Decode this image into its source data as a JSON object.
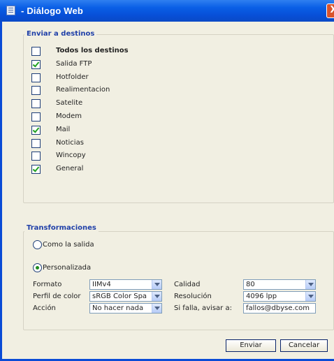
{
  "window": {
    "title": "- Diálogo Web",
    "close_glyph": "X",
    "title_icon": "document-icon"
  },
  "destinations": {
    "legend": "Enviar a destinos",
    "items": [
      {
        "label": "Todos los destinos",
        "checked": false,
        "bold": true
      },
      {
        "label": "Salida FTP",
        "checked": true
      },
      {
        "label": "Hotfolder",
        "checked": false
      },
      {
        "label": "Realimentacion",
        "checked": false
      },
      {
        "label": "Satelite",
        "checked": false
      },
      {
        "label": "Modem",
        "checked": false
      },
      {
        "label": "Mail",
        "checked": true
      },
      {
        "label": "Noticias",
        "checked": false
      },
      {
        "label": "Wincopy",
        "checked": false
      },
      {
        "label": "General",
        "checked": true
      }
    ]
  },
  "transformations": {
    "legend": "Transformaciones",
    "radio_same": "Como la salida",
    "radio_custom": "Personalizada",
    "selected": "custom",
    "formato_label": "Formato",
    "formato_value": "IIMv4",
    "perfil_label": "Perfil de color",
    "perfil_value": "sRGB Color Spa",
    "accion_label": "Acción",
    "accion_value": "No hacer nada",
    "calidad_label": "Calidad",
    "calidad_value": "80",
    "resolucion_label": "Resolución",
    "resolucion_value": "4096 lpp",
    "avisar_label": "Si falla, avisar a:",
    "avisar_value": "fallos@dbyse.com"
  },
  "actions": {
    "send": "Enviar",
    "cancel": "Cancelar"
  },
  "colors": {
    "titlebar": "#0a5fe6",
    "legend": "#1f3fa8",
    "check": "#21a121",
    "panel": "#f1efe2"
  }
}
